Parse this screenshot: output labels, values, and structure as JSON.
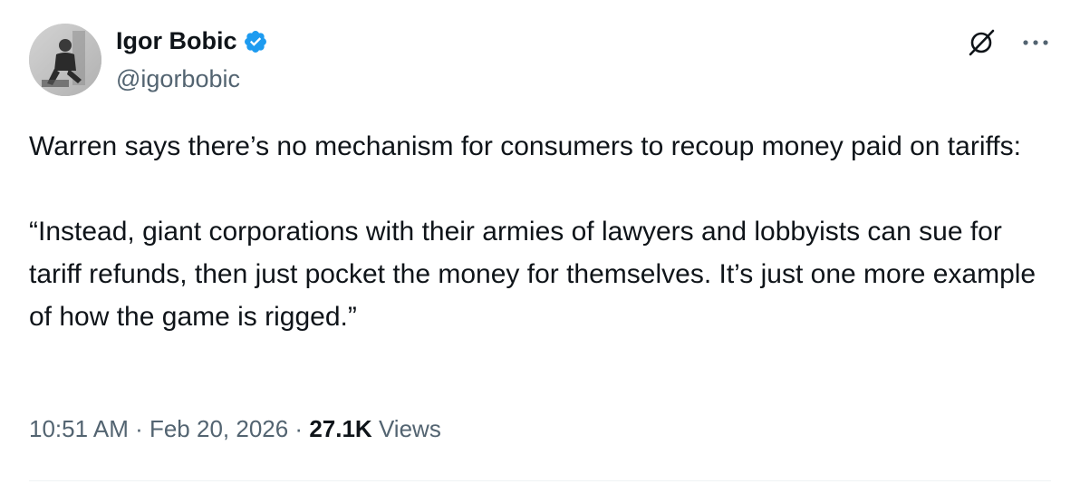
{
  "author": {
    "display_name": "Igor Bobic",
    "handle": "@igorbobic",
    "verified": true,
    "verified_color": "#1d9bf0"
  },
  "tweet": {
    "paragraphs": [
      "Warren says there’s no mechanism for consumers to recoup money paid on tariffs:",
      "“Instead, giant corporations with their armies of lawyers and lobbyists can sue for tariff refunds, then just pocket the money for themselves. It’s just one more example of how the game is rigged.”"
    ]
  },
  "meta": {
    "time": "10:51 AM",
    "separator": " · ",
    "date": "Feb 20, 2026",
    "views_count": "27.1K",
    "views_label": "Views"
  },
  "icons": {
    "grok": "grok-icon",
    "more": "more-icon",
    "verified": "verified-badge-icon"
  },
  "colors": {
    "text_primary": "#0f1419",
    "text_secondary": "#536471",
    "divider": "#eff3f4"
  }
}
